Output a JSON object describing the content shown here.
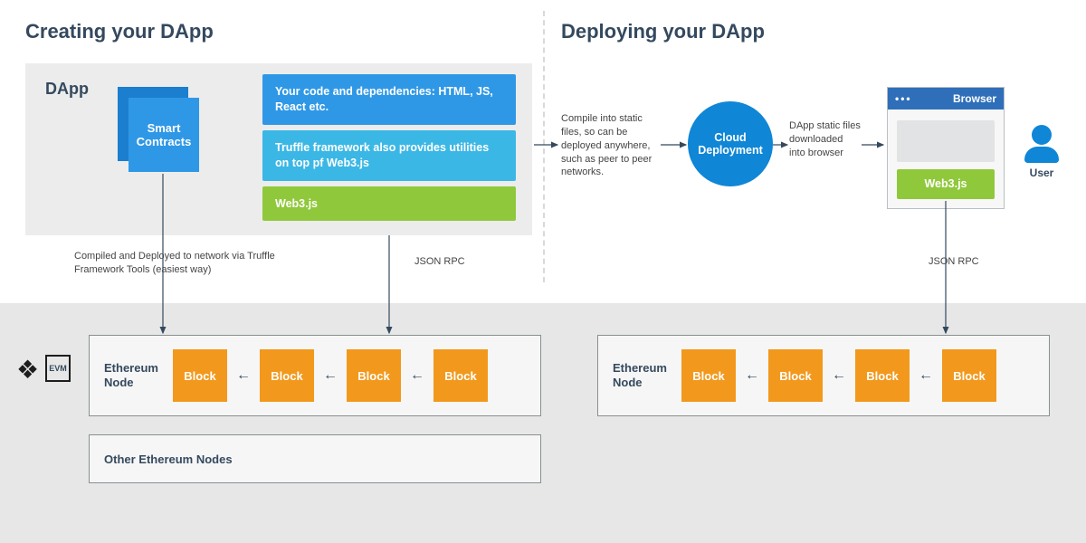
{
  "headings": {
    "create": "Creating your DApp",
    "deploy": "Deploying your DApp"
  },
  "dapp": {
    "panel_label": "DApp",
    "smart_contracts": "Smart Contracts",
    "code_box": "Your code and dependencies: HTML, JS, React etc.",
    "truffle_box": "Truffle framework also provides utilities on top pf Web3.js",
    "web3_box": "Web3.js"
  },
  "captions": {
    "compile_deploy": "Compiled and Deployed to network via Truffle Framework Tools (easiest way)",
    "json_rpc": "JSON RPC",
    "static_files": "Compile into static files, so can be deployed anywhere, such as peer to peer networks.",
    "download_browser": "DApp static files downloaded into browser"
  },
  "cloud": "Cloud Deployment",
  "browser": {
    "title": "Browser",
    "web3": "Web3.js"
  },
  "user_label": "User",
  "node": {
    "label": "Ethereum Node",
    "block": "Block",
    "other": "Other Ethereum Nodes"
  },
  "icons": {
    "eth": "❖",
    "evm": "EVM"
  }
}
